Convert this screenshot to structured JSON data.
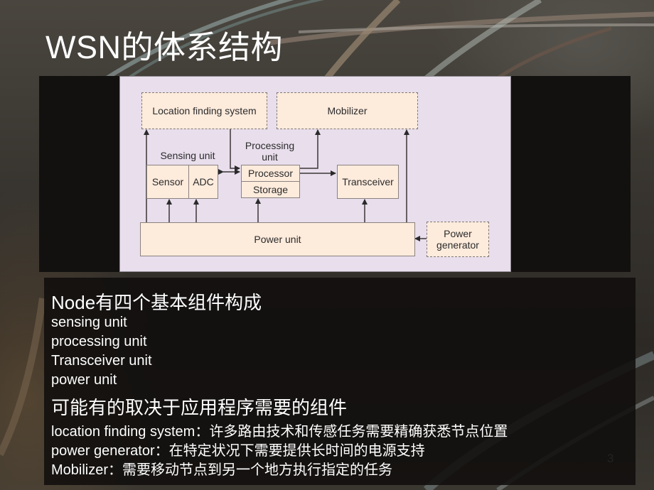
{
  "slide": {
    "title": "WSN的体系结构",
    "page_number": "3"
  },
  "diagram": {
    "location_finding_system": "Location finding system",
    "mobilizer": "Mobilizer",
    "sensing_unit_label": "Sensing unit",
    "processing_unit_label_1": "Processing",
    "processing_unit_label_2": "unit",
    "sensor": "Sensor",
    "adc": "ADC",
    "processor": "Processor",
    "storage": "Storage",
    "transceiver": "Transceiver",
    "power_unit": "Power unit",
    "power_generator_1": "Power",
    "power_generator_2": "generator"
  },
  "content": {
    "heading1": "Node有四个基本组件构成",
    "basic_components": [
      "sensing unit",
      "processing unit",
      "Transceiver unit",
      "power unit"
    ],
    "heading2": "可能有的取决于应用程序需要的组件",
    "optional_components": [
      "location finding system：许多路由技术和传感任务需要精确获悉节点位置",
      "power generator：在特定状况下需要提供长时间的电源支持",
      "Mobilizer：需要移动节点到另一个地方执行指定的任务"
    ]
  }
}
